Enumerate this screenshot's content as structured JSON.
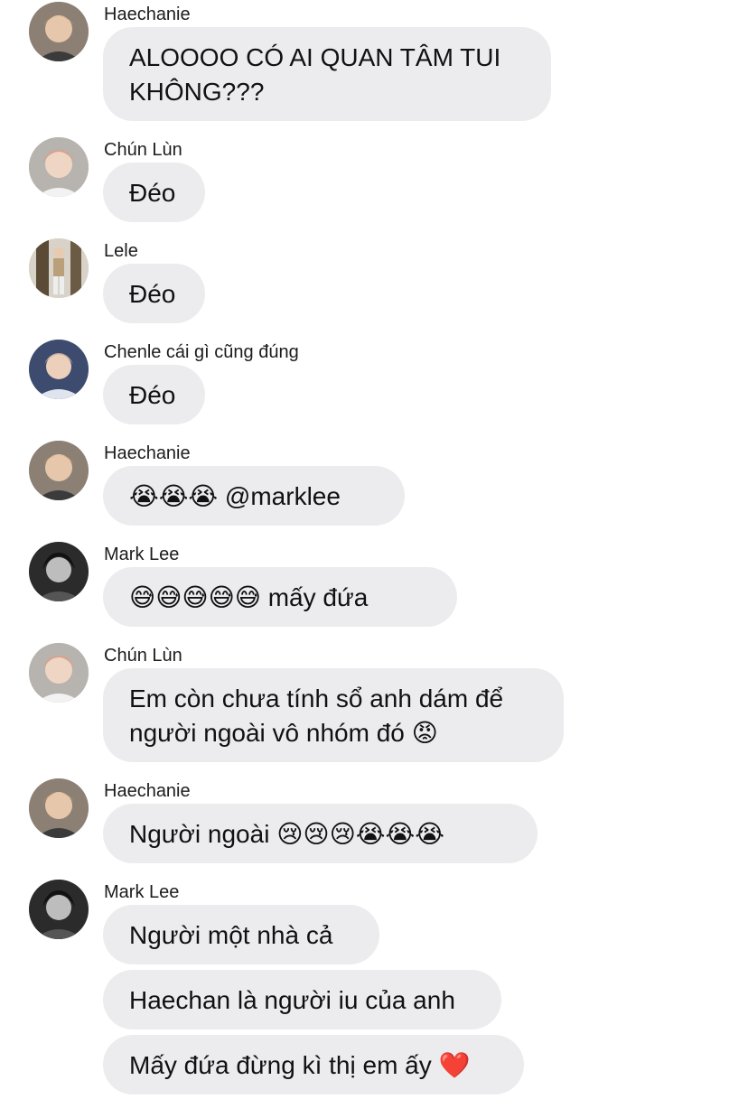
{
  "messages": [
    {
      "sender": "Haechanie",
      "lines": [
        "ALOOOO CÓ AI QUAN TÂM TUI",
        "KHÔNG???"
      ]
    },
    {
      "sender": "Chún Lùn",
      "lines": [
        "Đéo"
      ]
    },
    {
      "sender": "Lele",
      "lines": [
        "Đéo"
      ]
    },
    {
      "sender": "Chenle cái gì cũng đúng",
      "lines": [
        "Đéo"
      ]
    },
    {
      "sender": "Haechanie",
      "lines": [
        "😭😭😭 @marklee"
      ]
    },
    {
      "sender": "Mark Lee",
      "lines": [
        "😅😅😅😅😅 mấy đứa"
      ]
    },
    {
      "sender": "Chún Lùn",
      "lines": [
        "Em còn chưa tính sổ anh dám để",
        "người ngoài vô nhóm đó 😡"
      ]
    },
    {
      "sender": "Haechanie",
      "lines": [
        "Người ngoài 😢😢😢😭😭😭"
      ]
    },
    {
      "sender": "Mark Lee",
      "lines": [
        "Người một nhà cả"
      ]
    },
    {
      "sender": "Mark Lee",
      "lines": [
        "Haechan là người iu của anh"
      ]
    },
    {
      "sender": "Mark Lee",
      "lines": [
        "Mấy đứa đừng kì thị em ấy ❤️"
      ]
    }
  ],
  "colors": {
    "bubble_bg": "#ececee",
    "text": "#111111",
    "background": "#ffffff"
  }
}
